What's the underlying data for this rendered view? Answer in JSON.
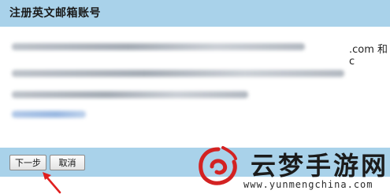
{
  "header": {
    "title": "注册英文邮箱账号"
  },
  "content": {
    "visible_fragment": ".com 和 c"
  },
  "actions": {
    "next_label": "下一步",
    "cancel_label": "取消"
  },
  "annotation": {
    "arrow_color": "#e02020"
  },
  "watermark": {
    "text": "云梦手游网",
    "url": "www.yunmengchina.com",
    "logo_color": "#d32222"
  },
  "colors": {
    "bar": "#a9d2ea",
    "background": "#ffffff"
  }
}
